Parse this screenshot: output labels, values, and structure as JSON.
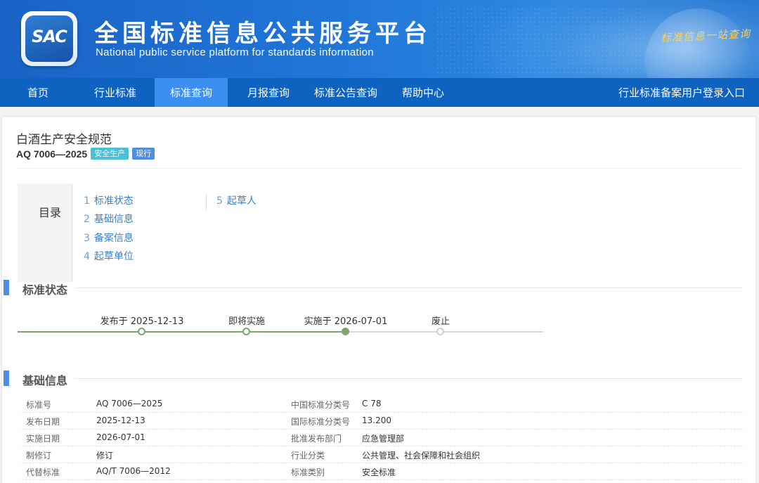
{
  "header": {
    "logo_text": "SAC",
    "title": "全国标准信息公共服务平台",
    "subtitle": "National public service platform  for standards information",
    "slogan": "标准信息一站查询"
  },
  "nav": {
    "items": [
      "首页",
      "行业标准",
      "标准查询",
      "月报查询",
      "标准公告查询",
      "帮助中心"
    ],
    "active": "标准查询",
    "login": "行业标准备案用户登录入口"
  },
  "standard": {
    "name": "白酒生产安全规范",
    "code": "AQ 7006—2025",
    "category_badge": "安全生产",
    "status_badge": "现行"
  },
  "toc": {
    "label": "目录",
    "items": [
      {
        "num": "1",
        "label": "标准状态"
      },
      {
        "num": "2",
        "label": "基础信息"
      },
      {
        "num": "3",
        "label": "备案信息"
      },
      {
        "num": "4",
        "label": "起草单位"
      },
      {
        "num": "5",
        "label": "起草人"
      }
    ]
  },
  "status_section": {
    "title": "标准状态",
    "steps": [
      {
        "label": "发布于 2025-12-13",
        "state": "done"
      },
      {
        "label": "即将实施",
        "state": "done"
      },
      {
        "label": "实施于 2026-07-01",
        "state": "current"
      },
      {
        "label": "废止",
        "state": "todo"
      }
    ]
  },
  "basic_section": {
    "title": "基础信息",
    "rows": [
      {
        "k1": "标准号",
        "v1": "AQ 7006—2025",
        "k2": "中国标准分类号",
        "v2": "C 78"
      },
      {
        "k1": "发布日期",
        "v1": "2025-12-13",
        "k2": "国际标准分类号",
        "v2": "13.200"
      },
      {
        "k1": "实施日期",
        "v1": "2026-07-01",
        "k2": "批准发布部门",
        "v2": "应急管理部"
      },
      {
        "k1": "制修订",
        "v1": "修订",
        "k2": "行业分类",
        "v2": "公共管理、社会保障和社会组织"
      },
      {
        "k1": "代替标准",
        "v1": "AQ/T 7006—2012",
        "k2": "标准类别",
        "v2": "安全标准"
      }
    ]
  },
  "colors": {
    "banner": "#1f74d6",
    "nav": "#0f63c0",
    "nav_active": "#3a8ff0",
    "link": "#3e7fc4",
    "timeline_done": "#7da66f",
    "section_bar": "#4c8fe0"
  }
}
